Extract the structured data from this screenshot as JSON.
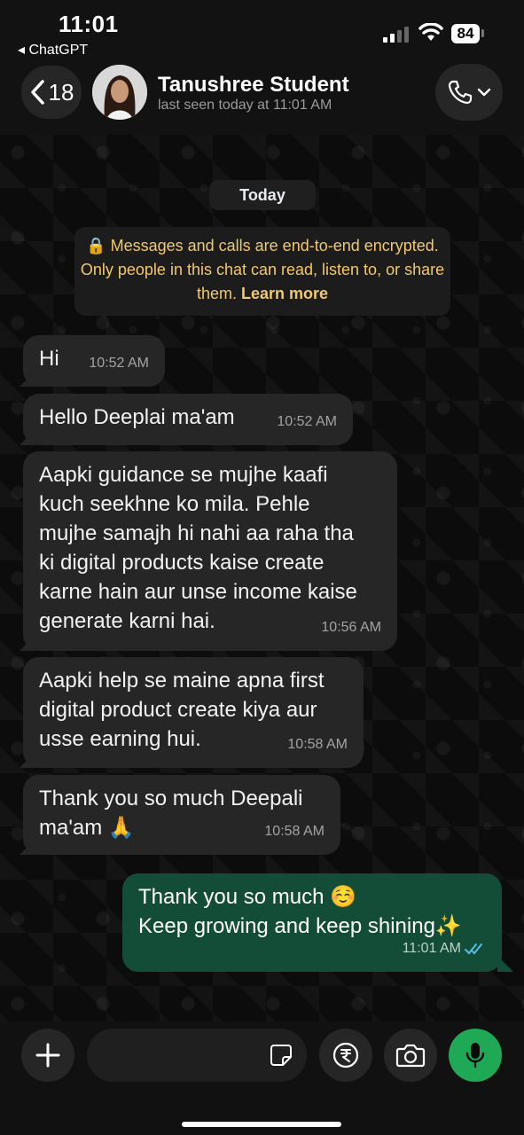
{
  "status_bar": {
    "time": "11:01",
    "back_app": "◂ ChatGPT",
    "battery": "84"
  },
  "header": {
    "back_count": "18",
    "contact_name": "Tanushree Student",
    "last_seen": "last seen today at 11:01 AM"
  },
  "chat": {
    "date_label": "Today",
    "encryption_text": "🔒 Messages and calls are end-to-end encrypted. Only people in this chat can read, listen to, or share them.",
    "encryption_link": "Learn more",
    "messages": [
      {
        "direction": "in",
        "text": "Hi",
        "time": "10:52 AM"
      },
      {
        "direction": "in",
        "text": "Hello Deeplai ma'am",
        "time": "10:52 AM"
      },
      {
        "direction": "in",
        "text": "Aapki guidance se mujhe kaafi\nkuch seekhne ko mila. Pehle\nmujhe samajh hi nahi aa raha tha\nki digital products kaise create\nkarne hain aur unse income kaise\ngenerate karni hai.",
        "time": "10:56 AM"
      },
      {
        "direction": "in",
        "text": "Aapki help se maine apna first\ndigital product create kiya aur\nusse earning hui.",
        "time": "10:58 AM"
      },
      {
        "direction": "in",
        "text": "Thank you so much Deepali\nma'am 🙏",
        "time": "10:58 AM"
      },
      {
        "direction": "out",
        "text": "Thank you so much ☺️\nKeep growing and keep shining✨",
        "time": "11:01 AM",
        "status": "read-double-check"
      }
    ]
  },
  "colors": {
    "accent_green": "#1fa855",
    "outgoing_bubble": "#144d37",
    "incoming_bubble": "#262626",
    "encryption_text": "#f3c86a",
    "read_tick": "#53bdeb"
  },
  "icons": [
    "chevron-left-icon",
    "phone-icon",
    "chevron-down-icon",
    "plus-icon",
    "sticker-icon",
    "rupee-icon",
    "camera-icon",
    "mic-icon",
    "double-check-icon",
    "lock-icon"
  ]
}
